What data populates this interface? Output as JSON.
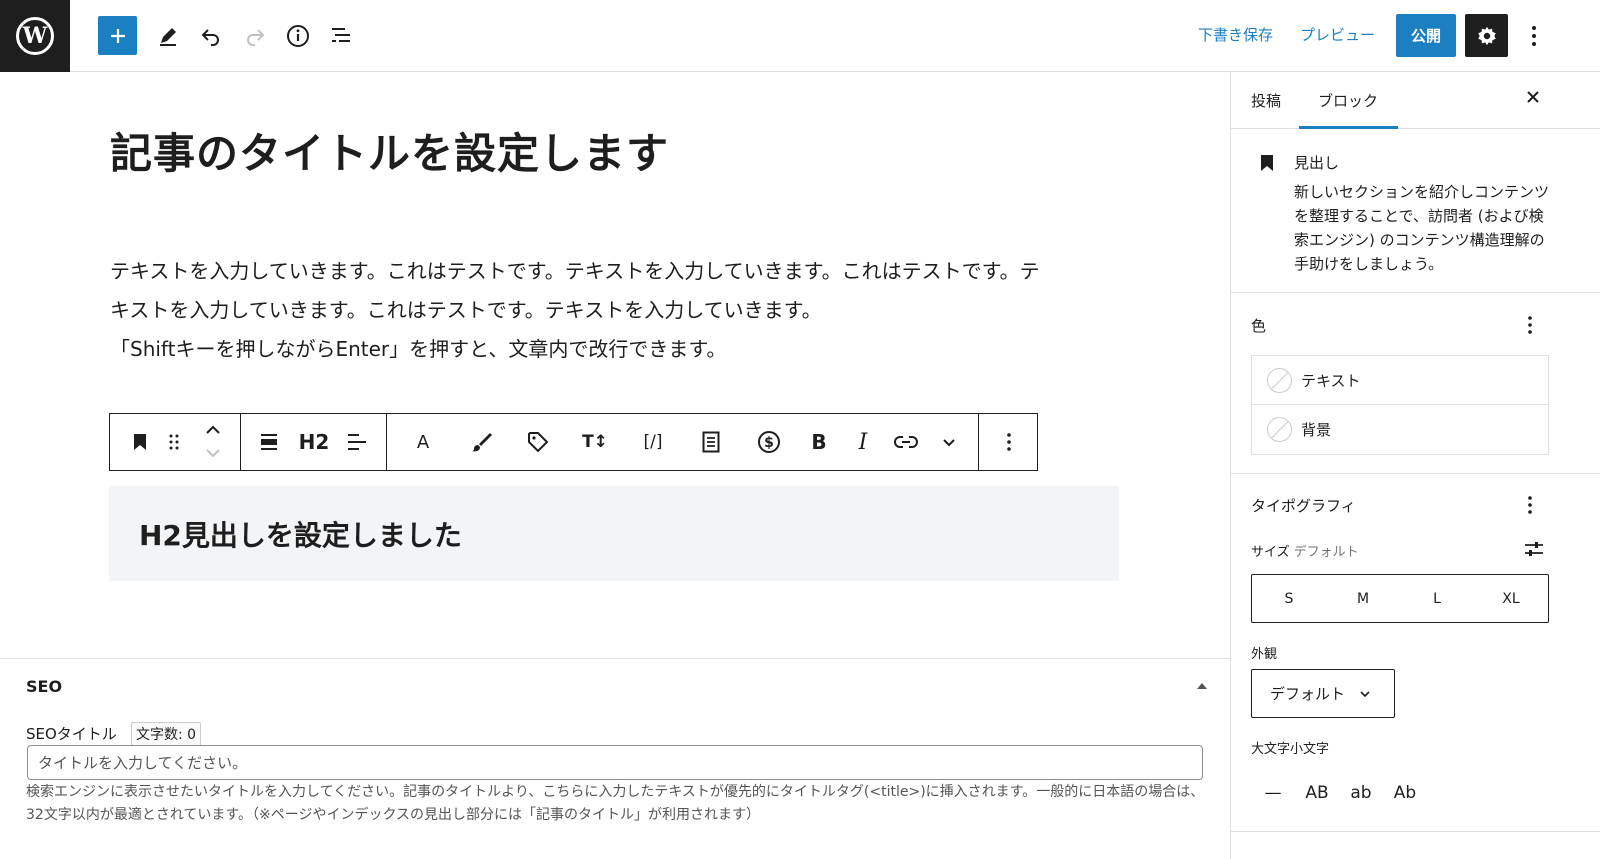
{
  "topbar": {
    "save_draft": "下書き保存",
    "preview": "プレビュー",
    "publish": "公開"
  },
  "editor": {
    "post_title": "記事のタイトルを設定します",
    "paragraph_lines": [
      "テキストを入力していきます。これはテストです。テキストを入力していきます。これはテストです。テ",
      "キストを入力していきます。これはテストです。テキストを入力していきます。",
      "「Shiftキーを押しながらEnter」を押すと、文章内で改行できます。"
    ],
    "block_toolbar": {
      "heading_level": "H2",
      "text_color": "A",
      "typography": "T↕",
      "shortcode": "[/]",
      "bold": "B",
      "italic": "I"
    },
    "heading_block_text": "H2見出しを設定しました"
  },
  "seo": {
    "section_title": "SEO",
    "title_label": "SEOタイトル",
    "char_count": "文字数: 0",
    "title_placeholder": "タイトルを入力してください。",
    "help_text": "検索エンジンに表示させたいタイトルを入力してください。記事のタイトルより、こちらに入力したテキストが優先的にタイトルタグ(<title>)に挿入されます。一般的に日本語の場合は、32文字以内が最適とされています。（※ページやインデックスの見出し部分には「記事のタイトル」が利用されます）"
  },
  "sidebar": {
    "tabs": [
      {
        "label": "投稿"
      },
      {
        "label": "ブロック"
      }
    ],
    "block_card": {
      "title": "見出し",
      "description": "新しいセクションを紹介しコンテンツを整理することで、訪問者 (および検索エンジン) のコンテンツ構造理解の手助けをしましょう。"
    },
    "color": {
      "title": "色",
      "options": [
        {
          "label": "テキスト"
        },
        {
          "label": "背景"
        }
      ]
    },
    "typography": {
      "title": "タイポグラフィ",
      "size_label": "サイズ",
      "size_default": "デフォルト",
      "sizes": [
        "S",
        "M",
        "L",
        "XL"
      ],
      "appearance_label": "外観",
      "appearance_value": "デフォルト",
      "letter_case_label": "大文字小文字",
      "letter_case_options": [
        "—",
        "AB",
        "ab",
        "Ab"
      ]
    }
  },
  "colors": {
    "accent": "#1c7fc1",
    "dark": "#1e1e1e",
    "heading_block_bg": "#f3f4f5"
  }
}
